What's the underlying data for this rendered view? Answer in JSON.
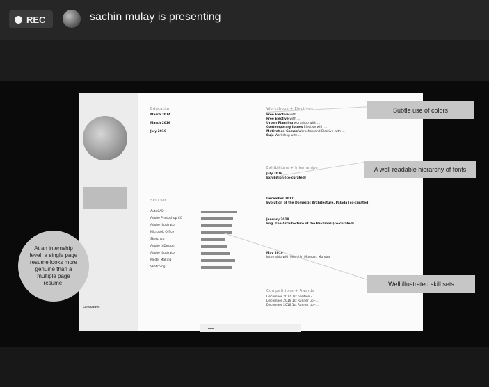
{
  "top": {
    "rec_label": "REC",
    "presenter": "sachin mulay is presenting"
  },
  "slide": {
    "sidebar": {
      "email_tag": "",
      "contact_heading": "",
      "contact_lines": [
        "",
        "",
        "",
        ""
      ],
      "languages_heading": "Languages",
      "languages": [
        "",
        "",
        ""
      ]
    },
    "education": {
      "heading": "Education",
      "items": [
        {
          "date": "March 2014",
          "text": ""
        },
        {
          "date": "March 2016",
          "text": ""
        },
        {
          "date": "July 2016",
          "text": ""
        },
        {
          "date": "",
          "text": ""
        }
      ]
    },
    "skills": {
      "heading": "Skill set",
      "items": [
        {
          "name": "AutoCAD",
          "level": 0.9
        },
        {
          "name": "Adobe Photoshop CC",
          "level": 0.8
        },
        {
          "name": "Adobe Illustrator",
          "level": 0.75
        },
        {
          "name": "Microsoft Office",
          "level": 0.75
        },
        {
          "name": "Sketchup",
          "level": 0.6
        },
        {
          "name": "Adobe InDesign",
          "level": 0.65
        },
        {
          "name": "Adobe Illustrator",
          "level": 0.7
        },
        {
          "name": "Model Making",
          "level": 0.85
        },
        {
          "name": "Sketching",
          "level": 0.75
        }
      ],
      "notes": [
        "",
        "",
        ""
      ]
    },
    "workshops": {
      "heading": "Workshops + Electives",
      "items": [
        {
          "b": "Free Elective",
          "t": "with ..."
        },
        {
          "b": "Free Elective",
          "t": "with ..."
        },
        {
          "b": "Urban Planning",
          "t": "workshop with ..."
        },
        {
          "b": "Contemporary Issues",
          "t": "Elective with ..."
        },
        {
          "b": "Motivation Games",
          "t": "Workshop and Elective with ..."
        },
        {
          "b": "Sujo",
          "t": "Workshop with ..."
        }
      ]
    },
    "exhibitions": {
      "heading": "Exhibitions + Internships",
      "items": [
        {
          "date": "July 2016",
          "title": "Exhibition (co-curated)"
        },
        {
          "date": "December 2017",
          "title": "Evolution of the Domestic Architecture, Palada (co-curated)"
        },
        {
          "date": "January 2018",
          "title": "Eng. The Architecture of the Pavilions (co-curated)"
        },
        {
          "date": "May 2019",
          "title": "Internship with Model In Mumbai, Mumbai"
        }
      ]
    },
    "competitions": {
      "heading": "Competitions + Awards",
      "items": [
        "December 2017 1st position - ...",
        "December 2016 1st Runner up - ...",
        "December 2016 1st Runner up - ..."
      ]
    },
    "player": {
      "text": "",
      "button": ""
    }
  },
  "annotations": {
    "colors": "Subtle use of colors",
    "hierarchy": "A well readable hierarchy of fonts",
    "skills": "Well illustrated skill sets",
    "circle": "At an internship level, a single page resume looks more genuine than a multiple page resume."
  }
}
